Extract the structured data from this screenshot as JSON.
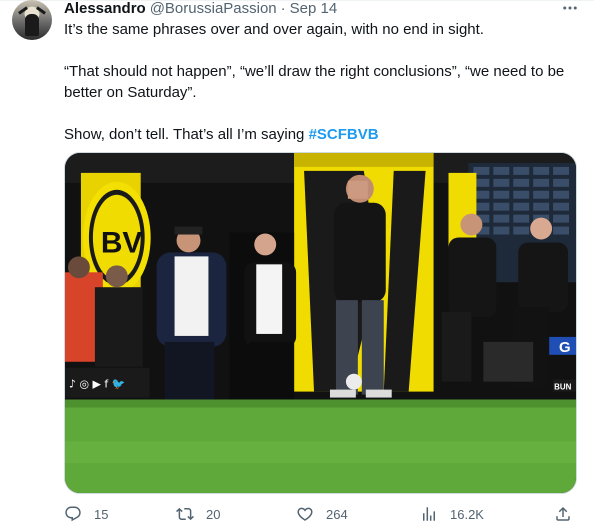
{
  "author": {
    "name": "Alessandro",
    "handle": "@BorussiaPassion",
    "separator": "·",
    "date": "Sep 14"
  },
  "tweet": {
    "line1": "It’s the same phrases over and over again, with no end in sight.",
    "line2": "“That should not happen”, “we’ll draw the right conclusions”, “we need to be better on Saturday”.",
    "line3_text": "Show, don’t tell. That’s all I’m saying ",
    "hashtag": "#SCFBVB"
  },
  "media": {
    "social_strip": "♪ ◎ ▶ f 🐦",
    "stadium_sign": "BV",
    "ad_corner_text": "G",
    "ad_bottom_text": "BUN"
  },
  "actions": {
    "replies": "15",
    "retweets": "20",
    "likes": "264",
    "views": "16.2K"
  },
  "icons": {
    "more": "more-icon",
    "reply": "reply-icon",
    "retweet": "retweet-icon",
    "like": "heart-icon",
    "views": "views-icon",
    "share": "share-icon"
  },
  "colors": {
    "text": "#0f1419",
    "secondary": "#536471",
    "accent": "#1d9bf0",
    "pitch": "#5fa83a",
    "bvb_yellow": "#f7e600"
  }
}
